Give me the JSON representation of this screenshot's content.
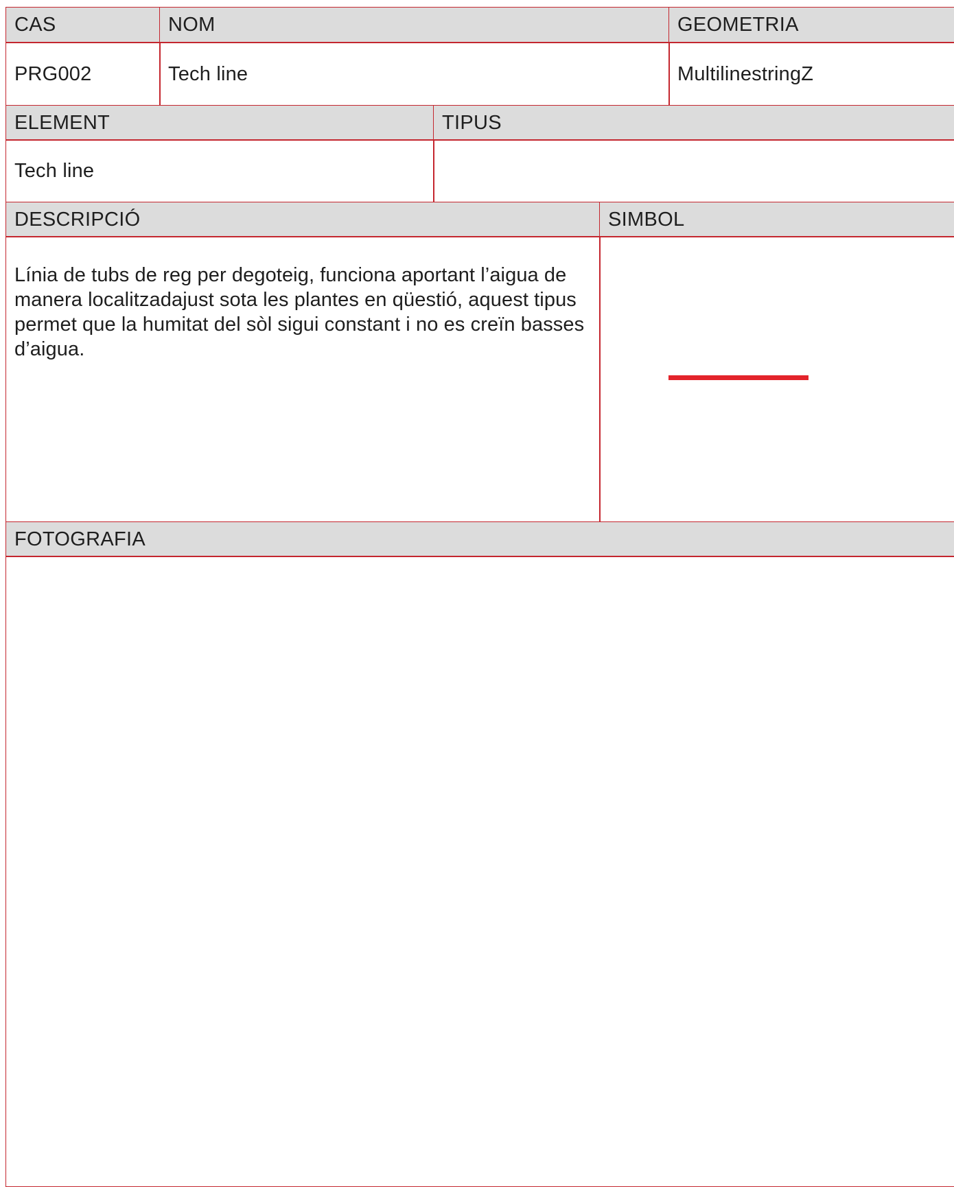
{
  "row1": {
    "cas_label": "CAS",
    "nom_label": "NOM",
    "geometria_label": "GEOMETRIA",
    "cas_value": "PRG002",
    "nom_value": "Tech line",
    "geometria_value": "MultilinestringZ"
  },
  "row2": {
    "element_label": "ELEMENT",
    "tipus_label": "TIPUS",
    "element_value": "Tech line",
    "tipus_value": ""
  },
  "row3": {
    "descripcio_label": "DESCRIPCIÓ",
    "simbol_label": "SIMBOL",
    "descripcio_value": "Línia de tubs de reg per degoteig, funciona aportant l’aigua de manera localitzadajust sota les plantes en qüestió, aquest tipus permet que la humitat del sòl sigui constant i no es creïn basses d’aigua.",
    "symbol_color": "#e3242b"
  },
  "row4": {
    "fotografia_label": "FOTOGRAFIA"
  }
}
